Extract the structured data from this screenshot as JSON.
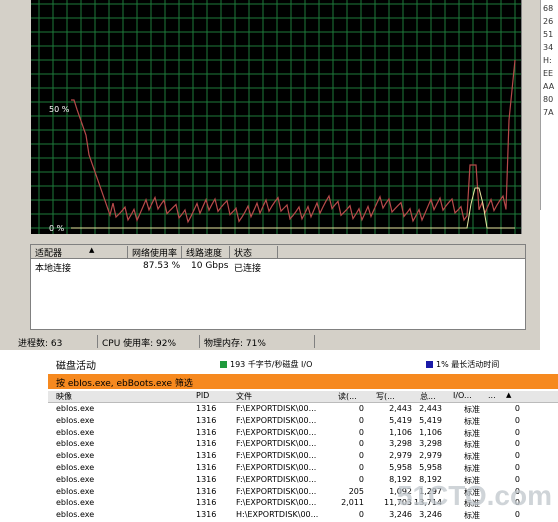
{
  "graph": {
    "y_labels": [
      "50 %",
      "0 %"
    ],
    "trace_color": "#b84a4a",
    "grid_color": "#1e7a3a"
  },
  "adapter_table": {
    "headers": [
      "适配器",
      "网络使用率",
      "线路速度",
      "状态"
    ],
    "rows": [
      {
        "name": "本地连接",
        "usage": "87.53 %",
        "speed": "10 Gbps",
        "state": "已连接"
      }
    ]
  },
  "status_bar": {
    "processes": "进程数: 63",
    "cpu": "CPU 使用率: 92%",
    "memory": "物理内存: 71%"
  },
  "hex_column": [
    "68",
    "26",
    "51",
    "34",
    "H:",
    "EE",
    "AA",
    "80",
    "7A"
  ],
  "disk_panel": {
    "title": "磁盘活动",
    "throughput": "193 千字节/秒磁盘 I/O",
    "throughput_color": "#1f9a3c",
    "active_time": "1% 最长活动时间",
    "active_color": "#1a1aa8",
    "filter_text": "按 ebIos.exe, ebBoots.exe 筛选",
    "filter_color": "#f6891f",
    "columns": [
      "映像",
      "PID",
      "文件",
      "读(...",
      "写(...",
      "总...",
      "I/O...",
      "..."
    ],
    "rows": [
      [
        "ebIos.exe",
        "1316",
        "F:\\EXPORTDISK\\00...",
        "0",
        "2,443",
        "2,443",
        "标准",
        "0"
      ],
      [
        "ebIos.exe",
        "1316",
        "F:\\EXPORTDISK\\00...",
        "0",
        "5,419",
        "5,419",
        "标准",
        "0"
      ],
      [
        "ebIos.exe",
        "1316",
        "F:\\EXPORTDISK\\00...",
        "0",
        "1,106",
        "1,106",
        "标准",
        "0"
      ],
      [
        "ebIos.exe",
        "1316",
        "F:\\EXPORTDISK\\00...",
        "0",
        "3,298",
        "3,298",
        "标准",
        "0"
      ],
      [
        "ebIos.exe",
        "1316",
        "F:\\EXPORTDISK\\00...",
        "0",
        "2,979",
        "2,979",
        "标准",
        "0"
      ],
      [
        "ebIos.exe",
        "1316",
        "F:\\EXPORTDISK\\00...",
        "0",
        "5,958",
        "5,958",
        "标准",
        "0"
      ],
      [
        "ebIos.exe",
        "1316",
        "F:\\EXPORTDISK\\00...",
        "0",
        "8,192",
        "8,192",
        "标准",
        "0"
      ],
      [
        "ebIos.exe",
        "1316",
        "F:\\EXPORTDISK\\00...",
        "205",
        "1,092",
        "1,297",
        "标准",
        "0"
      ],
      [
        "ebIos.exe",
        "1316",
        "F:\\EXPORTDISK\\00...",
        "2,011",
        "11,703",
        "13,714",
        "标准",
        "0"
      ],
      [
        "ebIos.exe",
        "1316",
        "H:\\EXPORTDISK\\00...",
        "0",
        "3,246",
        "3,246",
        "标准",
        "0"
      ]
    ],
    "watermark": "51CTO.com"
  }
}
